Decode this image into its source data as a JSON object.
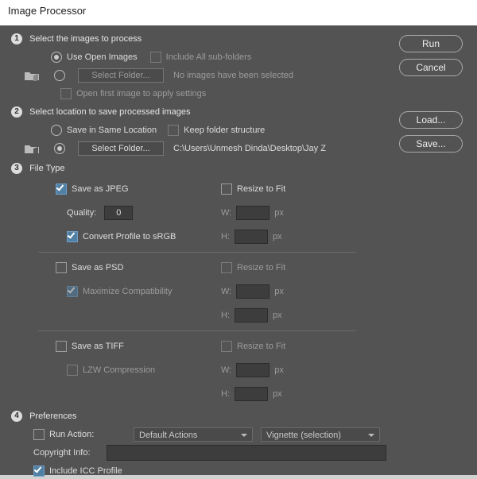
{
  "window": {
    "title": "Image Processor"
  },
  "buttons": {
    "run": "Run",
    "cancel": "Cancel",
    "load": "Load...",
    "save": "Save..."
  },
  "step1": {
    "badge": "1",
    "heading": "Select the images to process",
    "use_open_images": "Use Open Images",
    "include_subfolders": "Include All sub-folders",
    "select_folder_btn": "Select Folder...",
    "no_images": "No images have been selected",
    "open_first": "Open first image to apply settings"
  },
  "step2": {
    "badge": "2",
    "heading": "Select location to save processed images",
    "save_same": "Save in Same Location",
    "keep_folder": "Keep folder structure",
    "select_folder_btn": "Select Folder...",
    "path": "C:\\Users\\Unmesh Dinda\\Desktop\\Jay Z"
  },
  "step3": {
    "badge": "3",
    "heading": "File Type",
    "jpeg": {
      "save_as": "Save as JPEG",
      "quality_label": "Quality:",
      "quality_value": "0",
      "convert_srgb": "Convert Profile to sRGB",
      "resize": "Resize to Fit",
      "w": "W:",
      "h": "H:",
      "px": "px"
    },
    "psd": {
      "save_as": "Save as PSD",
      "max_compat": "Maximize Compatibility",
      "resize": "Resize to Fit",
      "w": "W:",
      "h": "H:",
      "px": "px"
    },
    "tiff": {
      "save_as": "Save as TIFF",
      "lzw": "LZW Compression",
      "resize": "Resize to Fit",
      "w": "W:",
      "h": "H:",
      "px": "px"
    }
  },
  "step4": {
    "badge": "4",
    "heading": "Preferences",
    "run_action": "Run Action:",
    "action_set": "Default Actions",
    "action_name": "Vignette (selection)",
    "copyright": "Copyright Info:",
    "include_icc": "Include ICC Profile"
  }
}
